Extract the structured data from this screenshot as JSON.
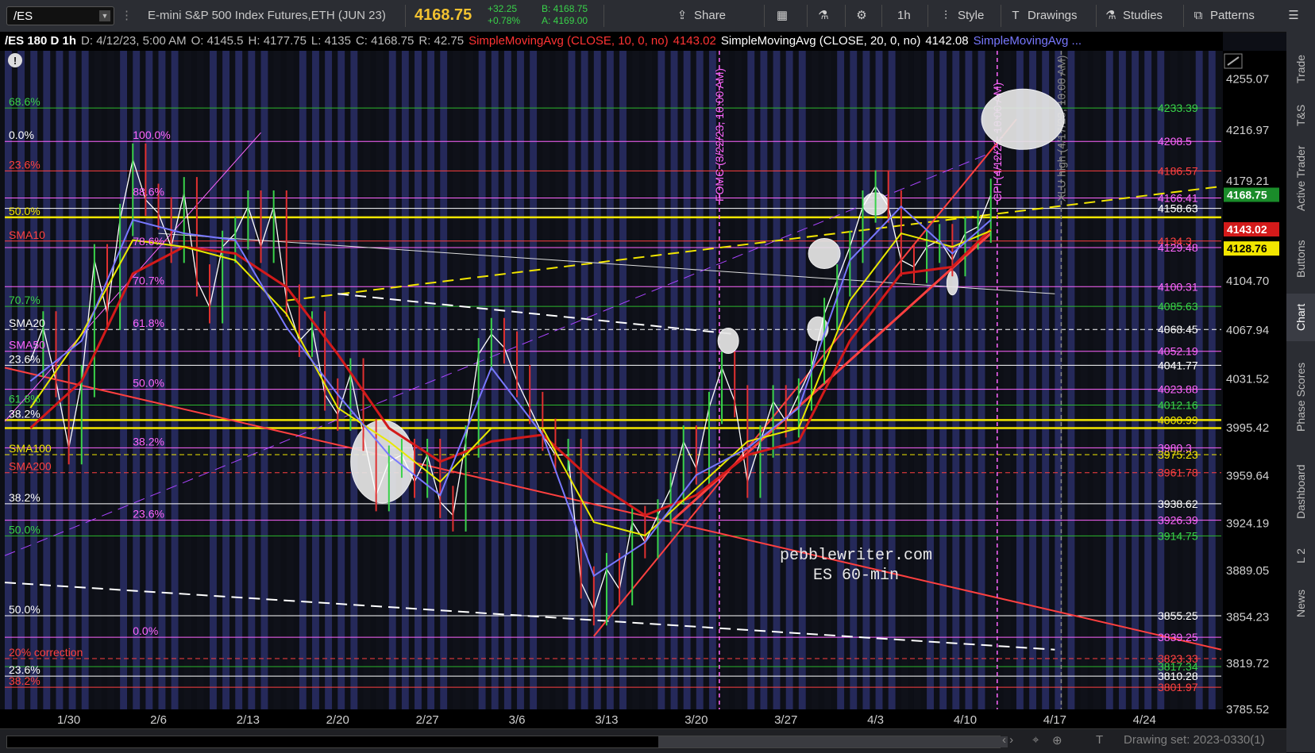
{
  "toolbar": {
    "symbol": "/ES",
    "description": "E-mini S&P 500 Index Futures,ETH (JUN 23)",
    "last_price": "4168.75",
    "change": "+32.25",
    "change_pct": "+0.78%",
    "bid": "B: 4168.75",
    "ask": "A: 4169.00",
    "share_label": "Share",
    "timeframe_label": "1h",
    "style_label": "Style",
    "drawings_label": "Drawings",
    "studies_label": "Studies",
    "patterns_label": "Patterns",
    "accent_color": "#f2c230",
    "up_color": "#39d24a"
  },
  "infobar": {
    "chart_id": "/ES 180 D 1h",
    "date": "D: 4/12/23, 5:00 AM",
    "open": "O: 4145.5",
    "high": "H: 4177.75",
    "low": "L: 4135",
    "close": "C: 4168.75",
    "range": "R: 42.75",
    "sma10": "SimpleMovingAvg (CLOSE, 10, 0, no)",
    "sma10_val": "4143.02",
    "sma20": "SimpleMovingAvg (CLOSE, 20, 0, no)",
    "sma20_val": "4142.08",
    "sma3": "SimpleMovingAvg ..."
  },
  "side_panel": [
    "Trade",
    "T&S",
    "Active Trader",
    "Buttons",
    "Chart",
    "Phase Scores",
    "Dashboard",
    "L 2",
    "News"
  ],
  "bottom": {
    "drawing_set": "Drawing set: 2023-0330(1)"
  },
  "chart_data": {
    "type": "candlestick",
    "symbol": "/ES",
    "interval": "1h",
    "ylim": [
      3785.52,
      4276
    ],
    "y_ticks": [
      4255.07,
      4216.97,
      4179.21,
      4104.7,
      4067.94,
      4031.52,
      3995.42,
      3959.64,
      3924.19,
      3889.05,
      3854.23,
      3819.72,
      3785.52
    ],
    "x_ticks": [
      "1/30",
      "2/6",
      "2/13",
      "2/20",
      "2/27",
      "3/6",
      "3/13",
      "3/20",
      "3/27",
      "4/3",
      "4/10",
      "4/17",
      "4/24"
    ],
    "x_tick_days": [
      3,
      10,
      17,
      24,
      31,
      38,
      45,
      52,
      59,
      66,
      73,
      80,
      87
    ],
    "day_range": [
      -2,
      93
    ],
    "last_price": 4168.75,
    "price_labels": [
      {
        "value": 4168.75,
        "text": "4168.75",
        "bg": "#1a8c2a",
        "fg": "#ffffff"
      },
      {
        "value": 4143.02,
        "text": "4143.02",
        "bg": "#d31a1a",
        "fg": "#ffffff"
      },
      {
        "value": 4128.76,
        "text": "4128.76",
        "bg": "#f2e600",
        "fg": "#000000"
      }
    ],
    "close_path": [
      [
        0,
        4045
      ],
      [
        1,
        4070
      ],
      [
        2,
        4030
      ],
      [
        3,
        3980
      ],
      [
        4,
        4030
      ],
      [
        5,
        4120
      ],
      [
        6,
        4080
      ],
      [
        7,
        4150
      ],
      [
        8,
        4195
      ],
      [
        9,
        4165
      ],
      [
        10,
        4155
      ],
      [
        11,
        4130
      ],
      [
        12,
        4170
      ],
      [
        13,
        4105
      ],
      [
        14,
        4085
      ],
      [
        15,
        4130
      ],
      [
        16,
        4140
      ],
      [
        17,
        4160
      ],
      [
        18,
        4130
      ],
      [
        19,
        4160
      ],
      [
        20,
        4090
      ],
      [
        21,
        4060
      ],
      [
        22,
        4070
      ],
      [
        23,
        4020
      ],
      [
        24,
        4005
      ],
      [
        25,
        4035
      ],
      [
        26,
        3990
      ],
      [
        27,
        3945
      ],
      [
        28,
        3970
      ],
      [
        29,
        3975
      ],
      [
        30,
        3955
      ],
      [
        31,
        3975
      ],
      [
        32,
        3940
      ],
      [
        33,
        3930
      ],
      [
        34,
        3985
      ],
      [
        35,
        4050
      ],
      [
        36,
        4065
      ],
      [
        37,
        4055
      ],
      [
        38,
        4030
      ],
      [
        39,
        4010
      ],
      [
        40,
        3990
      ],
      [
        41,
        3975
      ],
      [
        42,
        3975
      ],
      [
        43,
        3880
      ],
      [
        44,
        3860
      ],
      [
        45,
        3890
      ],
      [
        46,
        3875
      ],
      [
        47,
        3925
      ],
      [
        48,
        3910
      ],
      [
        49,
        3930
      ],
      [
        50,
        3950
      ],
      [
        51,
        3985
      ],
      [
        52,
        3965
      ],
      [
        53,
        4010
      ],
      [
        54,
        4040
      ],
      [
        55,
        4015
      ],
      [
        56,
        3955
      ],
      [
        57,
        3985
      ],
      [
        58,
        4015
      ],
      [
        59,
        4000
      ],
      [
        60,
        4020
      ],
      [
        61,
        4040
      ],
      [
        62,
        4080
      ],
      [
        63,
        4105
      ],
      [
        64,
        4130
      ],
      [
        65,
        4160
      ],
      [
        66,
        4175
      ],
      [
        67,
        4160
      ],
      [
        68,
        4120
      ],
      [
        69,
        4115
      ],
      [
        70,
        4130
      ],
      [
        71,
        4135
      ],
      [
        72,
        4120
      ],
      [
        73,
        4140
      ],
      [
        74,
        4145
      ],
      [
        75,
        4168.75
      ]
    ],
    "sma": [
      {
        "label": "SMA10",
        "color": "#d31a1a",
        "width": 3,
        "values": [
          [
            0,
            3995
          ],
          [
            4,
            4030
          ],
          [
            8,
            4110
          ],
          [
            12,
            4130
          ],
          [
            16,
            4125
          ],
          [
            20,
            4100
          ],
          [
            24,
            4050
          ],
          [
            28,
            3995
          ],
          [
            32,
            3970
          ],
          [
            36,
            3985
          ],
          [
            40,
            3990
          ],
          [
            44,
            3955
          ],
          [
            48,
            3930
          ],
          [
            52,
            3945
          ],
          [
            56,
            3975
          ],
          [
            60,
            3985
          ],
          [
            64,
            4060
          ],
          [
            68,
            4110
          ],
          [
            72,
            4115
          ],
          [
            75,
            4143
          ]
        ]
      },
      {
        "label": "SMA20",
        "color": "#e8e800",
        "width": 2,
        "values": [
          [
            0,
            4010
          ],
          [
            4,
            4065
          ],
          [
            8,
            4135
          ],
          [
            12,
            4130
          ],
          [
            16,
            4120
          ],
          [
            20,
            4080
          ],
          [
            24,
            4010
          ],
          [
            28,
            3985
          ],
          [
            32,
            3955
          ],
          [
            36,
            3995
          ],
          [
            40,
            3995
          ],
          [
            44,
            3925
          ],
          [
            48,
            3915
          ],
          [
            52,
            3950
          ],
          [
            56,
            3985
          ],
          [
            60,
            3995
          ],
          [
            64,
            4090
          ],
          [
            68,
            4140
          ],
          [
            72,
            4130
          ],
          [
            75,
            4142
          ]
        ]
      },
      {
        "label": "SMA3",
        "color": "#7878ff",
        "width": 2,
        "values": [
          [
            0,
            4030
          ],
          [
            4,
            4060
          ],
          [
            8,
            4150
          ],
          [
            12,
            4140
          ],
          [
            16,
            4135
          ],
          [
            20,
            4070
          ],
          [
            24,
            4020
          ],
          [
            28,
            3975
          ],
          [
            32,
            3945
          ],
          [
            36,
            4040
          ],
          [
            40,
            3990
          ],
          [
            44,
            3885
          ],
          [
            48,
            3910
          ],
          [
            52,
            3960
          ],
          [
            56,
            3980
          ],
          [
            60,
            4010
          ],
          [
            64,
            4120
          ],
          [
            68,
            4160
          ],
          [
            72,
            4125
          ],
          [
            75,
            4150
          ]
        ]
      }
    ],
    "h_levels": [
      {
        "value": 4233.39,
        "color": "#2db82d",
        "dash": false,
        "right_label": "4233.39",
        "label_color": "#39d24a"
      },
      {
        "value": 4208.5,
        "color": "#ff66ff",
        "dash": false,
        "right_label": "4208.5",
        "label_color": "#ff66ff"
      },
      {
        "value": 4186.57,
        "color": "#ff4040",
        "dash": false,
        "right_label": "4186.57",
        "label_color": "#ff4040"
      },
      {
        "value": 4166.41,
        "color": "#ff66ff",
        "dash": false,
        "right_label": "4166.41",
        "label_color": "#ff66ff"
      },
      {
        "value": 4158.63,
        "color": "#ffffff",
        "dash": false,
        "right_label": "4158.63",
        "label_color": "#ffffff"
      },
      {
        "value": 4152,
        "color": "#f2e600",
        "dash": false,
        "right_label": "",
        "label_color": "#f2e600"
      },
      {
        "value": 4134.3,
        "color": "#ff4040",
        "dash": false,
        "right_label": "4134.3",
        "label_color": "#ff4040"
      },
      {
        "value": 4129.48,
        "color": "#ff66ff",
        "dash": false,
        "right_label": "4129.48",
        "label_color": "#ff66ff"
      },
      {
        "value": 4100.31,
        "color": "#ff66ff",
        "dash": false,
        "right_label": "4100.31",
        "label_color": "#ff66ff"
      },
      {
        "value": 4085.63,
        "color": "#2db82d",
        "dash": false,
        "right_label": "4085.63",
        "label_color": "#39d24a"
      },
      {
        "value": 4068.45,
        "color": "#ffffff",
        "dash": true,
        "right_label": "4068.45",
        "label_color": "#ffffff"
      },
      {
        "value": 4052.19,
        "color": "#ff66ff",
        "dash": false,
        "right_label": "4052.19",
        "label_color": "#ff66ff"
      },
      {
        "value": 4041.77,
        "color": "#ffffff",
        "dash": false,
        "right_label": "4041.77",
        "label_color": "#ffffff"
      },
      {
        "value": 4023.88,
        "color": "#ff66ff",
        "dash": false,
        "right_label": "4023.88",
        "label_color": "#ff66ff"
      },
      {
        "value": 4012.16,
        "color": "#2db82d",
        "dash": false,
        "right_label": "4012.16",
        "label_color": "#39d24a"
      },
      {
        "value": 4000.99,
        "color": "#f2e600",
        "dash": false,
        "right_label": "4000.99",
        "label_color": "#f2e600"
      },
      {
        "value": 3995,
        "color": "#f2e600",
        "dash": false,
        "right_label": "",
        "label_color": "#f2e600"
      },
      {
        "value": 3980.3,
        "color": "#ff66ff",
        "dash": false,
        "right_label": "3980.3",
        "label_color": "#ff66ff"
      },
      {
        "value": 3975.23,
        "color": "#f2e600",
        "dash": true,
        "right_label": "3975.23",
        "label_color": "#f2e600"
      },
      {
        "value": 3961.78,
        "color": "#ff4040",
        "dash": true,
        "right_label": "3961.78",
        "label_color": "#ff4040"
      },
      {
        "value": 3938.62,
        "color": "#ffffff",
        "dash": false,
        "right_label": "3938.62",
        "label_color": "#ffffff"
      },
      {
        "value": 3926.39,
        "color": "#ff66ff",
        "dash": false,
        "right_label": "3926.39",
        "label_color": "#ff66ff"
      },
      {
        "value": 3914.75,
        "color": "#2db82d",
        "dash": false,
        "right_label": "3914.75",
        "label_color": "#39d24a"
      },
      {
        "value": 3855.25,
        "color": "#ffffff",
        "dash": false,
        "right_label": "3855.25",
        "label_color": "#ffffff"
      },
      {
        "value": 3839.25,
        "color": "#ff66ff",
        "dash": false,
        "right_label": "3839.25",
        "label_color": "#ff66ff"
      },
      {
        "value": 3823.33,
        "color": "#ff4040",
        "dash": true,
        "right_label": "3823.33",
        "label_color": "#ff4040"
      },
      {
        "value": 3817.34,
        "color": "#2db82d",
        "dash": false,
        "right_label": "3817.34",
        "label_color": "#39d24a"
      },
      {
        "value": 3810.28,
        "color": "#ffffff",
        "dash": false,
        "right_label": "3810.28",
        "label_color": "#ffffff"
      },
      {
        "value": 3801.97,
        "color": "#ff4040",
        "dash": false,
        "right_label": "3801.97",
        "label_color": "#ff4040"
      }
    ],
    "left_labels": [
      {
        "value": 4233.39,
        "text": "68.6%",
        "color": "#39d24a"
      },
      {
        "value": 4208.5,
        "text": "0.0%",
        "color": "#ffffff"
      },
      {
        "value": 4186.57,
        "text": "23.6%",
        "color": "#ff4040"
      },
      {
        "value": 4152,
        "text": "50.0%",
        "color": "#f2e600"
      },
      {
        "value": 4134.3,
        "text": "SMA10",
        "color": "#ff4040"
      },
      {
        "value": 4085.63,
        "text": "70.7%",
        "color": "#39d24a"
      },
      {
        "value": 4068.45,
        "text": "SMA20",
        "color": "#ffffff"
      },
      {
        "value": 4052.19,
        "text": "SMA50",
        "color": "#ff66ff"
      },
      {
        "value": 4041.77,
        "text": "23.6%",
        "color": "#ffffff"
      },
      {
        "value": 4012.16,
        "text": "61.8%",
        "color": "#39d24a"
      },
      {
        "value": 4000.99,
        "text": "38.2%",
        "color": "#ffffff"
      },
      {
        "value": 3975.23,
        "text": "SMA100",
        "color": "#f2e600"
      },
      {
        "value": 3961.78,
        "text": "SMA200",
        "color": "#ff4040"
      },
      {
        "value": 3938.62,
        "text": "38.2%",
        "color": "#ffffff"
      },
      {
        "value": 3914.75,
        "text": "50.0%",
        "color": "#39d24a"
      },
      {
        "value": 3855.25,
        "text": "50.0%",
        "color": "#ffffff"
      },
      {
        "value": 3823.33,
        "text": "20% correction",
        "color": "#ff4040"
      },
      {
        "value": 3810.28,
        "text": "23.6%",
        "color": "#ffffff"
      },
      {
        "value": 3801.97,
        "text": "38.2%",
        "color": "#ff4040"
      }
    ],
    "inner_labels": [
      {
        "value": 4208.5,
        "day": 8,
        "text": "100.0%",
        "color": "#ff66ff"
      },
      {
        "value": 4166.41,
        "day": 8,
        "text": "88.6%",
        "color": "#ff66ff"
      },
      {
        "value": 4129.48,
        "day": 8,
        "text": "78.6%",
        "color": "#ff66ff"
      },
      {
        "value": 4100.31,
        "day": 8,
        "text": "70.7%",
        "color": "#ff66ff"
      },
      {
        "value": 4068.45,
        "day": 8,
        "text": "61.8%",
        "color": "#ff66ff"
      },
      {
        "value": 4023.88,
        "day": 8,
        "text": "50.0%",
        "color": "#ff66ff"
      },
      {
        "value": 3980.3,
        "day": 8,
        "text": "38.2%",
        "color": "#ff66ff"
      },
      {
        "value": 3926.39,
        "day": 8,
        "text": "23.6%",
        "color": "#ff66ff"
      },
      {
        "value": 3839.25,
        "day": 8,
        "text": "0.0%",
        "color": "#ff66ff"
      }
    ],
    "event_lines": [
      {
        "day": 53.8,
        "text": "FOMC (3/22/23, 10:00 AM)",
        "color": "#ff66ff"
      },
      {
        "day": 75.5,
        "text": "CPI (4/12/23, 10:00 AM)",
        "color": "#ff66ff"
      },
      {
        "day": 80.5,
        "text": "XLU high (4/17/23, 10:00 AM)",
        "color": "#888888"
      }
    ],
    "annotations": [
      "pebblewriter.com",
      "ES  60-min"
    ],
    "trendlines": [
      {
        "from": [
          -2,
          4040
        ],
        "to": [
          93,
          3830
        ],
        "color": "#ff4040",
        "width": 2
      },
      {
        "from": [
          -2,
          3880
        ],
        "to": [
          80,
          3830
        ],
        "color": "#ffffff",
        "width": 2,
        "dash": true
      },
      {
        "from": [
          20,
          4090
        ],
        "to": [
          93,
          4175
        ],
        "color": "#f2e600",
        "width": 2,
        "dash": true
      },
      {
        "from": [
          10,
          4140
        ],
        "to": [
          80,
          4095
        ],
        "color": "#dddddd",
        "width": 1
      },
      {
        "from": [
          24,
          4095
        ],
        "to": [
          55,
          4065
        ],
        "color": "#ffffff",
        "width": 2,
        "dash": true
      },
      {
        "from": [
          44,
          3840
        ],
        "to": [
          77,
          4225
        ],
        "color": "#ff4040",
        "width": 2
      },
      {
        "from": [
          50,
          3925
        ],
        "to": [
          75,
          4140
        ],
        "color": "#ff4040",
        "width": 3
      },
      {
        "from": [
          -2,
          4000
        ],
        "to": [
          18,
          4215
        ],
        "color": "#ff66ff",
        "width": 1
      },
      {
        "from": [
          -2,
          3900
        ],
        "to": [
          75,
          4200
        ],
        "color": "#aa44ff",
        "width": 1,
        "dash": true
      }
    ],
    "ellipses": [
      {
        "day": 27.5,
        "value": 3970,
        "rx": 40,
        "ry": 52
      },
      {
        "day": 54.5,
        "value": 4060,
        "rx": 13,
        "ry": 16
      },
      {
        "day": 61.5,
        "value": 4069,
        "rx": 13,
        "ry": 15
      },
      {
        "day": 62,
        "value": 4125,
        "rx": 20,
        "ry": 19
      },
      {
        "day": 66,
        "value": 4162,
        "rx": 16,
        "ry": 14
      },
      {
        "day": 72,
        "value": 4103,
        "rx": 7,
        "ry": 15
      },
      {
        "day": 77.5,
        "value": 4225,
        "rx": 52,
        "ry": 38
      }
    ]
  }
}
